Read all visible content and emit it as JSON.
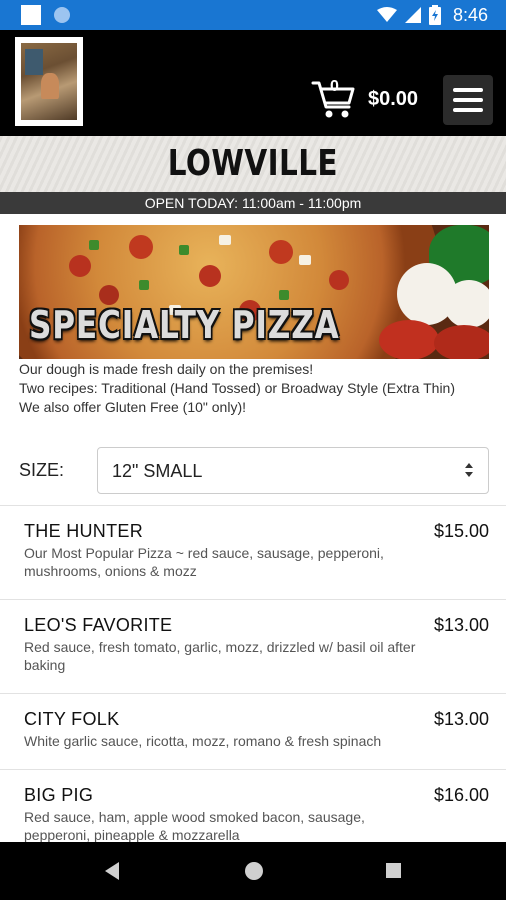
{
  "status_bar": {
    "time": "8:46",
    "icons": [
      "wifi-icon",
      "signal-icon",
      "battery-icon"
    ]
  },
  "header": {
    "cart_count": "0",
    "cart_total": "$0.00",
    "colors": {
      "background": "#000000",
      "accent": "#1976d2"
    }
  },
  "location": {
    "name": "LOWVILLE",
    "hours": "OPEN TODAY: 11:00am - 11:00pm"
  },
  "banner": {
    "title": "SPECIALTY PIZZA"
  },
  "description": {
    "line1": "Our dough is made fresh daily on the premises!",
    "line2": "Two recipes: Traditional (Hand Tossed) or Broadway Style (Extra Thin)",
    "line3": "We also offer Gluten Free (10\" only)!"
  },
  "size": {
    "label": "SIZE:",
    "selected": "12\" SMALL"
  },
  "items": [
    {
      "name": "THE HUNTER",
      "price": "$15.00",
      "desc": "Our Most Popular Pizza ~ red sauce, sausage, pepperoni, mushrooms, onions & mozz"
    },
    {
      "name": "LEO'S FAVORITE",
      "price": "$13.00",
      "desc": "Red sauce, fresh tomato, garlic, mozz, drizzled w/ basil oil after baking"
    },
    {
      "name": "CITY FOLK",
      "price": "$13.00",
      "desc": "White garlic sauce, ricotta, mozz, romano & fresh spinach"
    },
    {
      "name": "BIG PIG",
      "price": "$16.00",
      "desc": "Red sauce, ham, apple wood smoked bacon, sausage, pepperoni, pineapple & mozzarella"
    }
  ]
}
